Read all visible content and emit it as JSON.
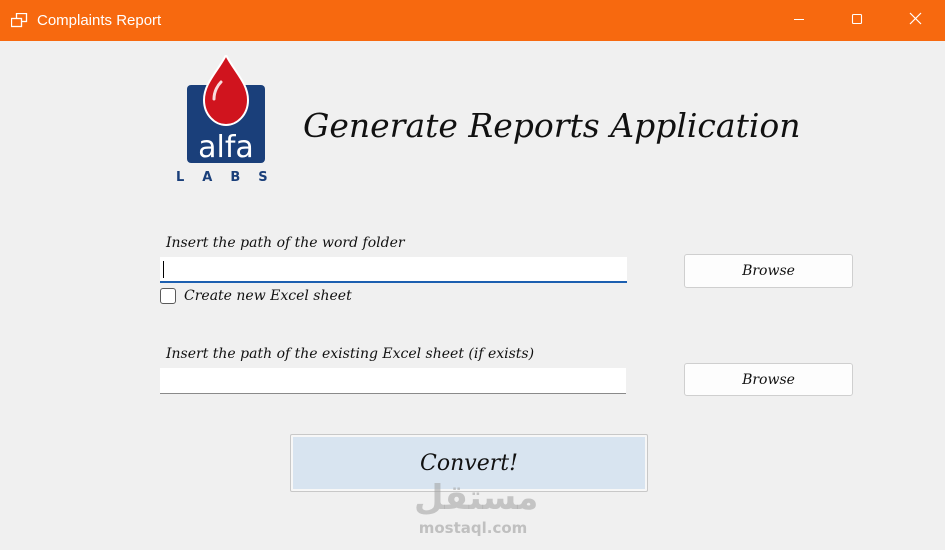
{
  "window": {
    "title": "Complaints Report",
    "accent_color": "#f7690f",
    "controls": {
      "minimize_icon": "minimize-icon",
      "maximize_icon": "maximize-icon",
      "close_icon": "close-icon"
    }
  },
  "logo": {
    "word": "alfa",
    "sub": "LABS",
    "brand_color": "#1a3f7a",
    "drop_color": "#d0141e"
  },
  "header": {
    "title": "Generate Reports Application"
  },
  "word_folder": {
    "label": "Insert the path of the word folder",
    "value": "",
    "browse_label": "Browse"
  },
  "new_excel": {
    "label": "Create new Excel sheet",
    "checked": false
  },
  "excel_sheet": {
    "label": "Insert the path of the existing Excel sheet (if exists)",
    "value": "",
    "browse_label": "Browse"
  },
  "convert": {
    "label": "Convert!"
  },
  "watermark": {
    "arabic": "مستقل",
    "latin": "mostaql.com"
  }
}
